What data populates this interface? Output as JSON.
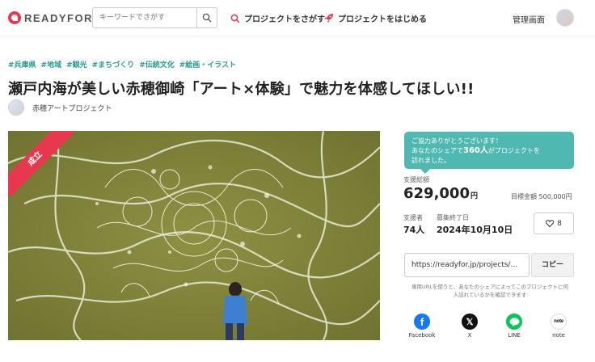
{
  "header": {
    "logo_text": "READYFOR",
    "search_placeholder": "キーワードでさがす",
    "nav_find": "プロジェクトをさがす",
    "nav_start": "プロジェクトをはじめる",
    "admin": "管理画面"
  },
  "tags": [
    "#兵庫県",
    "#地域",
    "#観光",
    "#まちづくり",
    "#伝統文化",
    "#絵画・イラスト"
  ],
  "project": {
    "title": "瀬戸内海が美しい赤穂御崎「アート×体験」で魅力を体感してほしい!!",
    "owner": "赤穂アートプロジェクト",
    "ribbon": "成立"
  },
  "panel": {
    "thanks_line1": "ご協力ありがとうございます！",
    "thanks_line2_pre": "あなたのシェアで",
    "thanks_line2_bold": "360人",
    "thanks_line2_post": "がプロジェクトを",
    "thanks_line3": "訪れました。",
    "total_label": "支援総額",
    "total_amount": "629,000",
    "total_unit": "円",
    "goal": "目標金額 500,000円",
    "backers_label": "支援者",
    "backers": "74人",
    "end_label": "募集終了日",
    "end_date": "2024年10月10日",
    "like_count": "8",
    "url": "https://readyfor.jp/projects/...",
    "copy": "コピー",
    "note": "専用URLを使うと、あなたのシェアによってこのプロジェクトに何人訪れているかを確認できます"
  },
  "share": [
    {
      "label": "Facebook",
      "icon": "facebook-icon",
      "color": "#1877f2"
    },
    {
      "label": "X",
      "icon": "x-icon",
      "color": "#111111"
    },
    {
      "label": "LINE",
      "icon": "line-icon",
      "color": "#06c755"
    },
    {
      "label": "note",
      "icon": "note-icon",
      "color": "#ffffff"
    }
  ],
  "colors": {
    "accent": "#e8384f",
    "teal": "#4fb8b0",
    "tag": "#2a9d8f"
  }
}
